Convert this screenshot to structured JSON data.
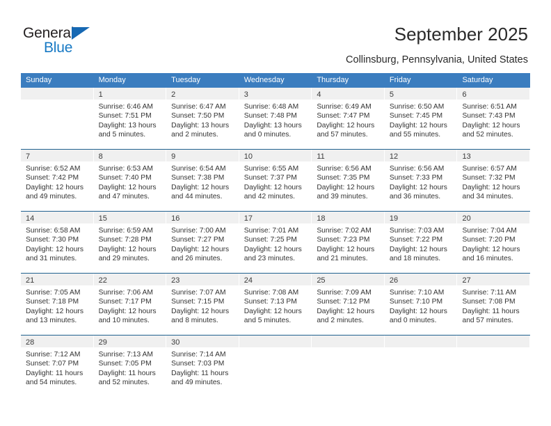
{
  "brand": {
    "name_part1": "General",
    "name_part2": "Blue",
    "accent_color": "#1779c4",
    "triangle_color": "#1668b3"
  },
  "header": {
    "title": "September 2025",
    "subtitle": "Collinsburg, Pennsylvania, United States"
  },
  "calendar": {
    "header_bg": "#3b7dbf",
    "row_divider_color": "#20618f",
    "daynum_bg": "#f0f0f0",
    "weekdays": [
      "Sunday",
      "Monday",
      "Tuesday",
      "Wednesday",
      "Thursday",
      "Friday",
      "Saturday"
    ],
    "weeks": [
      [
        {
          "day": "",
          "sunrise": "",
          "sunset": "",
          "daylight1": "",
          "daylight2": "",
          "empty": true
        },
        {
          "day": "1",
          "sunrise": "Sunrise: 6:46 AM",
          "sunset": "Sunset: 7:51 PM",
          "daylight1": "Daylight: 13 hours",
          "daylight2": "and 5 minutes."
        },
        {
          "day": "2",
          "sunrise": "Sunrise: 6:47 AM",
          "sunset": "Sunset: 7:50 PM",
          "daylight1": "Daylight: 13 hours",
          "daylight2": "and 2 minutes."
        },
        {
          "day": "3",
          "sunrise": "Sunrise: 6:48 AM",
          "sunset": "Sunset: 7:48 PM",
          "daylight1": "Daylight: 13 hours",
          "daylight2": "and 0 minutes."
        },
        {
          "day": "4",
          "sunrise": "Sunrise: 6:49 AM",
          "sunset": "Sunset: 7:47 PM",
          "daylight1": "Daylight: 12 hours",
          "daylight2": "and 57 minutes."
        },
        {
          "day": "5",
          "sunrise": "Sunrise: 6:50 AM",
          "sunset": "Sunset: 7:45 PM",
          "daylight1": "Daylight: 12 hours",
          "daylight2": "and 55 minutes."
        },
        {
          "day": "6",
          "sunrise": "Sunrise: 6:51 AM",
          "sunset": "Sunset: 7:43 PM",
          "daylight1": "Daylight: 12 hours",
          "daylight2": "and 52 minutes."
        }
      ],
      [
        {
          "day": "7",
          "sunrise": "Sunrise: 6:52 AM",
          "sunset": "Sunset: 7:42 PM",
          "daylight1": "Daylight: 12 hours",
          "daylight2": "and 49 minutes."
        },
        {
          "day": "8",
          "sunrise": "Sunrise: 6:53 AM",
          "sunset": "Sunset: 7:40 PM",
          "daylight1": "Daylight: 12 hours",
          "daylight2": "and 47 minutes."
        },
        {
          "day": "9",
          "sunrise": "Sunrise: 6:54 AM",
          "sunset": "Sunset: 7:38 PM",
          "daylight1": "Daylight: 12 hours",
          "daylight2": "and 44 minutes."
        },
        {
          "day": "10",
          "sunrise": "Sunrise: 6:55 AM",
          "sunset": "Sunset: 7:37 PM",
          "daylight1": "Daylight: 12 hours",
          "daylight2": "and 42 minutes."
        },
        {
          "day": "11",
          "sunrise": "Sunrise: 6:56 AM",
          "sunset": "Sunset: 7:35 PM",
          "daylight1": "Daylight: 12 hours",
          "daylight2": "and 39 minutes."
        },
        {
          "day": "12",
          "sunrise": "Sunrise: 6:56 AM",
          "sunset": "Sunset: 7:33 PM",
          "daylight1": "Daylight: 12 hours",
          "daylight2": "and 36 minutes."
        },
        {
          "day": "13",
          "sunrise": "Sunrise: 6:57 AM",
          "sunset": "Sunset: 7:32 PM",
          "daylight1": "Daylight: 12 hours",
          "daylight2": "and 34 minutes."
        }
      ],
      [
        {
          "day": "14",
          "sunrise": "Sunrise: 6:58 AM",
          "sunset": "Sunset: 7:30 PM",
          "daylight1": "Daylight: 12 hours",
          "daylight2": "and 31 minutes."
        },
        {
          "day": "15",
          "sunrise": "Sunrise: 6:59 AM",
          "sunset": "Sunset: 7:28 PM",
          "daylight1": "Daylight: 12 hours",
          "daylight2": "and 29 minutes."
        },
        {
          "day": "16",
          "sunrise": "Sunrise: 7:00 AM",
          "sunset": "Sunset: 7:27 PM",
          "daylight1": "Daylight: 12 hours",
          "daylight2": "and 26 minutes."
        },
        {
          "day": "17",
          "sunrise": "Sunrise: 7:01 AM",
          "sunset": "Sunset: 7:25 PM",
          "daylight1": "Daylight: 12 hours",
          "daylight2": "and 23 minutes."
        },
        {
          "day": "18",
          "sunrise": "Sunrise: 7:02 AM",
          "sunset": "Sunset: 7:23 PM",
          "daylight1": "Daylight: 12 hours",
          "daylight2": "and 21 minutes."
        },
        {
          "day": "19",
          "sunrise": "Sunrise: 7:03 AM",
          "sunset": "Sunset: 7:22 PM",
          "daylight1": "Daylight: 12 hours",
          "daylight2": "and 18 minutes."
        },
        {
          "day": "20",
          "sunrise": "Sunrise: 7:04 AM",
          "sunset": "Sunset: 7:20 PM",
          "daylight1": "Daylight: 12 hours",
          "daylight2": "and 16 minutes."
        }
      ],
      [
        {
          "day": "21",
          "sunrise": "Sunrise: 7:05 AM",
          "sunset": "Sunset: 7:18 PM",
          "daylight1": "Daylight: 12 hours",
          "daylight2": "and 13 minutes."
        },
        {
          "day": "22",
          "sunrise": "Sunrise: 7:06 AM",
          "sunset": "Sunset: 7:17 PM",
          "daylight1": "Daylight: 12 hours",
          "daylight2": "and 10 minutes."
        },
        {
          "day": "23",
          "sunrise": "Sunrise: 7:07 AM",
          "sunset": "Sunset: 7:15 PM",
          "daylight1": "Daylight: 12 hours",
          "daylight2": "and 8 minutes."
        },
        {
          "day": "24",
          "sunrise": "Sunrise: 7:08 AM",
          "sunset": "Sunset: 7:13 PM",
          "daylight1": "Daylight: 12 hours",
          "daylight2": "and 5 minutes."
        },
        {
          "day": "25",
          "sunrise": "Sunrise: 7:09 AM",
          "sunset": "Sunset: 7:12 PM",
          "daylight1": "Daylight: 12 hours",
          "daylight2": "and 2 minutes."
        },
        {
          "day": "26",
          "sunrise": "Sunrise: 7:10 AM",
          "sunset": "Sunset: 7:10 PM",
          "daylight1": "Daylight: 12 hours",
          "daylight2": "and 0 minutes."
        },
        {
          "day": "27",
          "sunrise": "Sunrise: 7:11 AM",
          "sunset": "Sunset: 7:08 PM",
          "daylight1": "Daylight: 11 hours",
          "daylight2": "and 57 minutes."
        }
      ],
      [
        {
          "day": "28",
          "sunrise": "Sunrise: 7:12 AM",
          "sunset": "Sunset: 7:07 PM",
          "daylight1": "Daylight: 11 hours",
          "daylight2": "and 54 minutes."
        },
        {
          "day": "29",
          "sunrise": "Sunrise: 7:13 AM",
          "sunset": "Sunset: 7:05 PM",
          "daylight1": "Daylight: 11 hours",
          "daylight2": "and 52 minutes."
        },
        {
          "day": "30",
          "sunrise": "Sunrise: 7:14 AM",
          "sunset": "Sunset: 7:03 PM",
          "daylight1": "Daylight: 11 hours",
          "daylight2": "and 49 minutes."
        },
        {
          "day": "",
          "sunrise": "",
          "sunset": "",
          "daylight1": "",
          "daylight2": "",
          "empty": true
        },
        {
          "day": "",
          "sunrise": "",
          "sunset": "",
          "daylight1": "",
          "daylight2": "",
          "empty": true
        },
        {
          "day": "",
          "sunrise": "",
          "sunset": "",
          "daylight1": "",
          "daylight2": "",
          "empty": true
        },
        {
          "day": "",
          "sunrise": "",
          "sunset": "",
          "daylight1": "",
          "daylight2": "",
          "empty": true
        }
      ]
    ]
  }
}
